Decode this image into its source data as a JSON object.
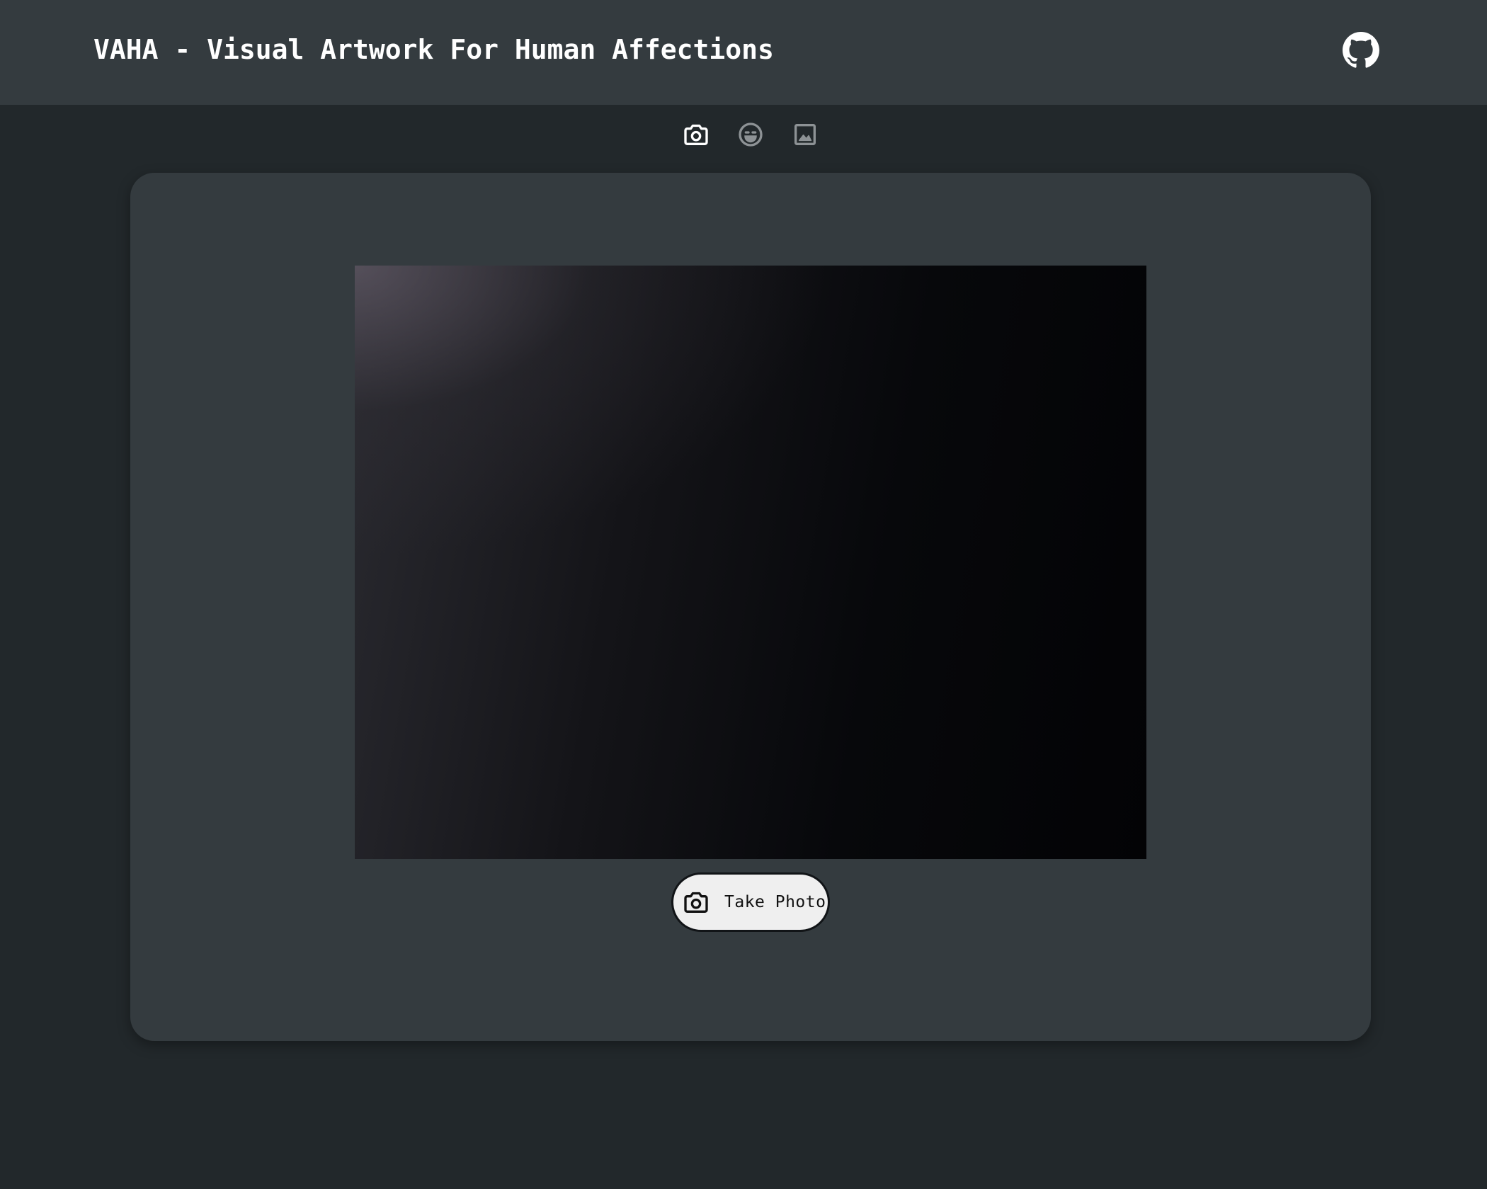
{
  "header": {
    "title": "VAHA - Visual Artwork For Human Affections",
    "github_icon": "github-icon"
  },
  "tabs": [
    {
      "icon": "camera-icon",
      "active": true
    },
    {
      "icon": "emoji-icon",
      "active": false
    },
    {
      "icon": "image-icon",
      "active": false
    }
  ],
  "capture": {
    "button_label": "Take Photo",
    "button_icon": "camera-icon"
  },
  "colors": {
    "background": "#22282b",
    "header_background": "#343b3f",
    "card_background": "#343b3f",
    "active_tab_icon": "#ffffff",
    "inactive_tab_icon": "#8d9295",
    "button_background": "#efefef"
  }
}
